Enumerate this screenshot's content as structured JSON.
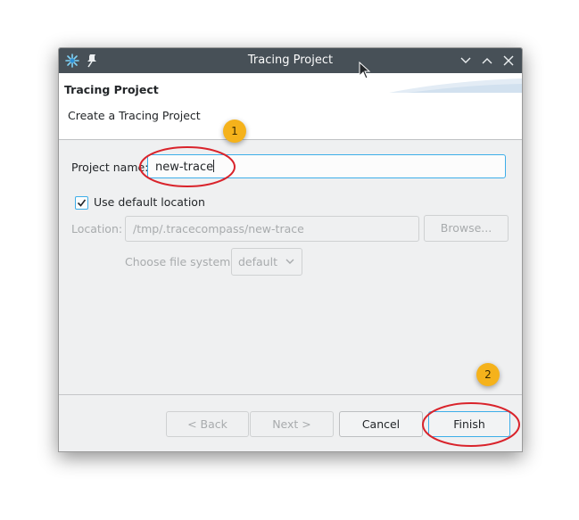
{
  "window": {
    "title": "Tracing Project"
  },
  "header": {
    "title": "Tracing Project",
    "description": "Create a Tracing Project"
  },
  "form": {
    "project_name_label": "Project name:",
    "project_name_value": "new-trace",
    "use_default_label": "Use default location",
    "use_default_checked": true,
    "location_label": "Location:",
    "location_value": "/tmp/.tracecompass/new-trace",
    "browse_label": "Browse...",
    "file_system_label": "Choose file system:",
    "file_system_value": "default"
  },
  "buttons": {
    "back": "< Back",
    "next": "Next >",
    "cancel": "Cancel",
    "finish": "Finish"
  },
  "annotations": {
    "badge_1": "1",
    "badge_2": "2",
    "badge_color": "#f5b21b",
    "ring_color": "#d9232b"
  },
  "colors": {
    "titlebar": "#475057",
    "accent": "#3daee9",
    "window_bg": "#eff0f1"
  }
}
